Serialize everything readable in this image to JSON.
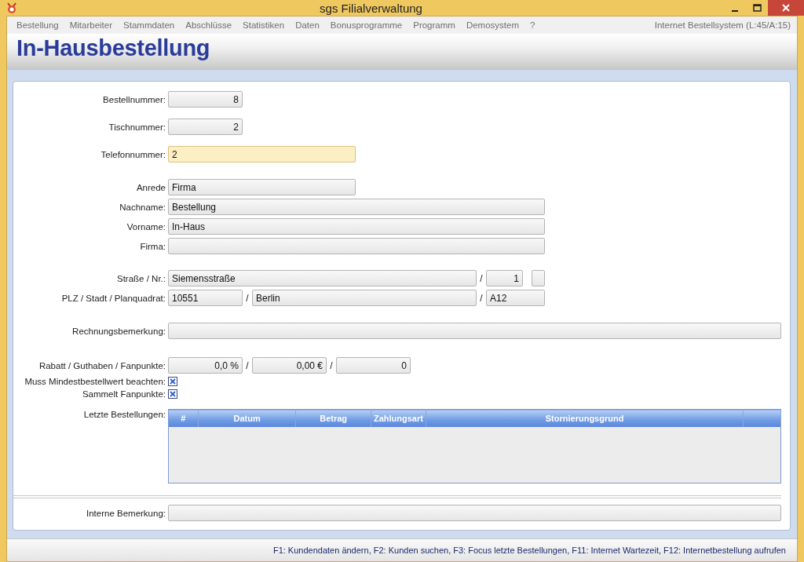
{
  "window": {
    "title": "sgs Filialverwaltung"
  },
  "menu": {
    "items": [
      "Bestellung",
      "Mitarbeiter",
      "Stammdaten",
      "Abschlüsse",
      "Statistiken",
      "Daten",
      "Bonusprogramme",
      "Programm",
      "Demosystem",
      "?"
    ],
    "info": "Internet Bestellsystem (L:45/A:15)"
  },
  "page_title": "In-Hausbestellung",
  "sections": [
    {
      "rows": [
        {
          "label": "Bestellnummer:",
          "parts": [
            {
              "kind": "number",
              "value": "8",
              "focused": false
            }
          ]
        },
        {
          "label": "Tischnummer:",
          "parts": [
            {
              "kind": "number",
              "value": "2",
              "focused": false
            }
          ]
        },
        {
          "label": "Telefonnummer:",
          "parts": [
            {
              "kind": "text",
              "value": "2",
              "focused": true
            }
          ]
        }
      ]
    },
    {
      "rows": [
        {
          "label": "Anrede",
          "parts": [
            {
              "kind": "text",
              "value": "Firma",
              "focused": false
            }
          ]
        },
        {
          "label": "Nachname:",
          "parts": [
            {
              "kind": "wide",
              "value": "Bestellung",
              "focused": false
            }
          ]
        },
        {
          "label": "Vorname:",
          "parts": [
            {
              "kind": "wide",
              "value": "In-Haus",
              "focused": false
            }
          ]
        },
        {
          "label": "Firma:",
          "parts": [
            {
              "kind": "wide",
              "focused": false
            }
          ]
        }
      ]
    },
    {
      "rows": [
        {
          "label": "Straße / Nr.:",
          "parts": [
            {
              "kind": "street",
              "value": "Siemensstraße",
              "focused": false
            },
            {
              "kind": "sep",
              "text": "/"
            },
            {
              "kind": "house-number",
              "value": "1",
              "focused": false
            },
            {
              "kind": "extra",
              "focused": false
            }
          ]
        },
        {
          "label": "PLZ / Stadt / Planquadrat:",
          "parts": [
            {
              "kind": "short-text",
              "value": "10551",
              "focused": false
            },
            {
              "kind": "sep",
              "text": "/"
            },
            {
              "kind": "city",
              "value": "Berlin",
              "focused": false
            },
            {
              "kind": "sep",
              "text": "/"
            },
            {
              "kind": "code",
              "value": "A12",
              "focused": false
            }
          ]
        }
      ]
    },
    {
      "rows": [
        {
          "label": "Rechnungsbemerkung:",
          "parts": [
            {
              "kind": "full",
              "focused": false
            }
          ]
        }
      ]
    },
    {
      "rows": [
        {
          "label": "Rabatt / Guthaben / Fanpunkte:",
          "parts": [
            {
              "kind": "number",
              "value": "0,0 %",
              "focused": false
            },
            {
              "kind": "sep",
              "text": "/"
            },
            {
              "kind": "number",
              "value": "0,00 €",
              "focused": false
            },
            {
              "kind": "sep",
              "text": "/"
            },
            {
              "kind": "number",
              "value": "0",
              "focused": false
            }
          ]
        },
        {
          "label": "Muss Mindestbestellwert beachten:",
          "kind": "checkbox",
          "checked": true
        },
        {
          "label": "Sammelt Fanpunkte:",
          "kind": "checkbox",
          "checked": true
        }
      ]
    }
  ],
  "orders": {
    "label": "Letzte Bestellungen:",
    "columns": [
      "#",
      "Datum",
      "Betrag",
      "Zahlungsart",
      "Stornierungsgrund",
      ""
    ]
  },
  "internal_note": {
    "label": "Interne Bemerkung:"
  },
  "status_bar": "F1: Kundendaten ändern, F2: Kunden suchen, F3: Focus letzte Bestellungen, F11: Internet Wartezeit, F12: Internetbestellung aufrufen"
}
